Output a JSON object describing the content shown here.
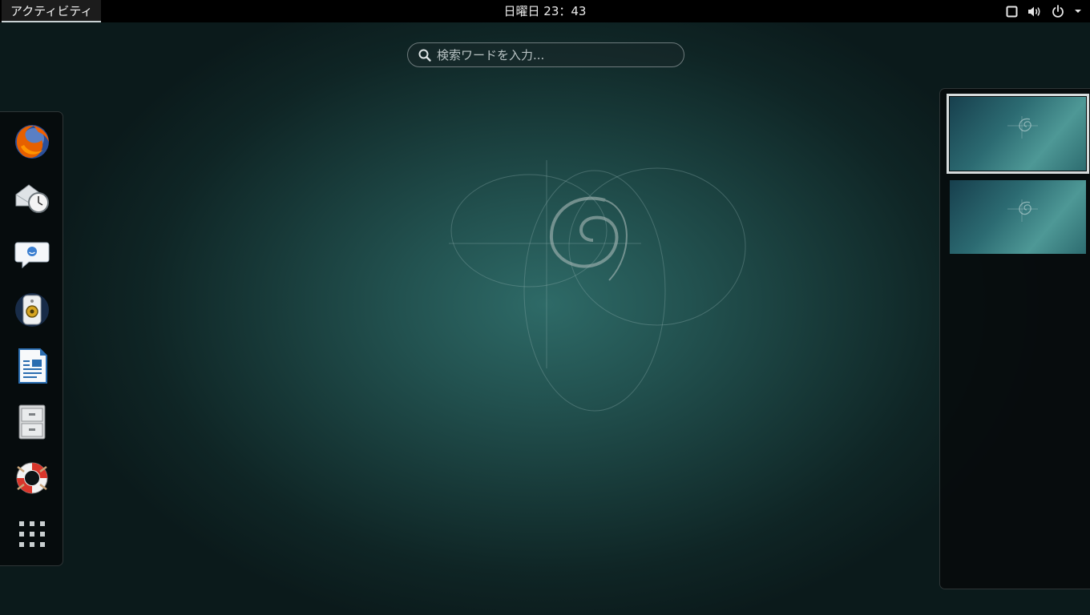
{
  "topbar": {
    "activities_label": "アクティビティ",
    "clock": "日曜日 23：43"
  },
  "status_icons": [
    "window-icon",
    "volume-icon",
    "power-icon",
    "menu-arrow-icon"
  ],
  "search": {
    "placeholder": "検索ワードを入力..."
  },
  "dash": {
    "items": [
      {
        "name": "Firefox",
        "icon": "firefox-icon"
      },
      {
        "name": "Evolution",
        "icon": "mail-clock-icon"
      },
      {
        "name": "Empathy",
        "icon": "chat-icon"
      },
      {
        "name": "Rhythmbox",
        "icon": "speaker-icon"
      },
      {
        "name": "LibreOffice Writer",
        "icon": "writer-icon"
      },
      {
        "name": "Files",
        "icon": "file-cabinet-icon"
      },
      {
        "name": "Help",
        "icon": "lifebuoy-icon"
      },
      {
        "name": "Show Applications",
        "icon": "app-grid-icon"
      }
    ]
  },
  "workspaces": {
    "count": 2,
    "active": 0
  },
  "colors": {
    "topbar_bg": "#000000",
    "wallpaper_center": "#2e6a67",
    "wallpaper_edge": "#0b1a1b"
  }
}
